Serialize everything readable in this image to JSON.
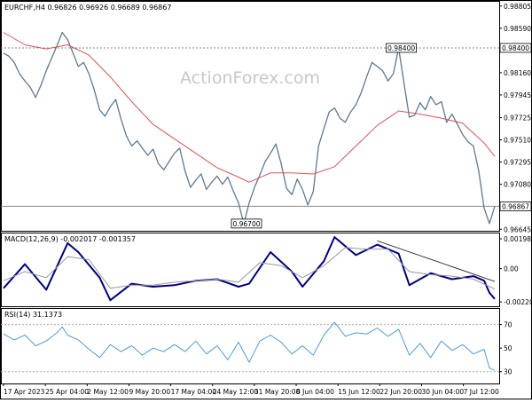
{
  "chart_data": [
    {
      "type": "line",
      "panel": "price",
      "header": "EURCHF,H4  0.96826 0.96926 0.96689 0.96867",
      "watermark": "ActionForex.com",
      "x_ticks": [
        "17 Apr 2023",
        "25 Apr 04:00",
        "2 May 12:00",
        "9 May 20:00",
        "17 May 04:00",
        "24 May 12:00",
        "31 May 20:00",
        "8 Jun 04:00",
        "15 Jun 12:00",
        "22 Jun 20:00",
        "30 Jun 04:00",
        "7 Jul 12:00"
      ],
      "y_ticks": [
        0.96645,
        0.9708,
        0.97295,
        0.9751,
        0.97725,
        0.97945,
        0.9816,
        0.9859,
        0.98805
      ],
      "ylim": [
        0.9663,
        0.98855
      ],
      "grid": false,
      "reference_lines": [
        {
          "value": 0.984,
          "label": "0.98400"
        },
        {
          "value": 0.96867,
          "label": "0.96867"
        }
      ],
      "annotations": [
        {
          "text": "0.98400",
          "x": 74.5,
          "y": 0.984
        },
        {
          "text": "0.96700",
          "x": 45.5,
          "y": 0.967
        }
      ],
      "x_max": 92,
      "series": [
        {
          "color": "#5b7a95",
          "x": [
            0,
            1,
            2,
            3,
            4,
            5,
            6,
            7,
            8,
            9,
            10,
            11,
            12,
            13,
            14,
            15,
            16,
            17,
            18,
            19,
            20,
            21,
            22,
            23,
            24,
            25,
            26,
            27,
            28,
            29,
            30,
            31,
            32,
            33,
            34,
            35,
            36,
            37,
            38,
            39,
            40,
            41,
            42,
            43,
            44,
            45,
            46,
            47,
            48,
            49,
            50,
            51,
            52,
            53,
            54,
            55,
            56,
            57,
            58,
            59,
            60,
            61,
            62,
            63,
            64,
            65,
            66,
            67,
            68,
            69,
            70,
            71,
            72,
            73,
            74,
            75,
            76,
            77,
            78,
            79,
            80,
            81,
            82,
            83,
            84,
            85,
            86,
            87,
            88,
            89,
            90,
            91,
            92
          ],
          "values": [
            0.9835,
            0.9832,
            0.9826,
            0.9815,
            0.9808,
            0.9802,
            0.9792,
            0.9804,
            0.9818,
            0.983,
            0.9842,
            0.9855,
            0.9848,
            0.9835,
            0.9822,
            0.9826,
            0.9815,
            0.9799,
            0.978,
            0.9774,
            0.9783,
            0.979,
            0.9771,
            0.9755,
            0.9745,
            0.975,
            0.9743,
            0.9736,
            0.9742,
            0.9728,
            0.9722,
            0.973,
            0.9738,
            0.9743,
            0.9721,
            0.9705,
            0.9712,
            0.9718,
            0.9703,
            0.971,
            0.9716,
            0.9708,
            0.9715,
            0.9702,
            0.969,
            0.967,
            0.969,
            0.9705,
            0.9717,
            0.973,
            0.9738,
            0.9747,
            0.9728,
            0.9704,
            0.9698,
            0.9713,
            0.9703,
            0.9688,
            0.9701,
            0.9745,
            0.9762,
            0.9778,
            0.9782,
            0.9772,
            0.9768,
            0.9778,
            0.9785,
            0.9797,
            0.9812,
            0.9826,
            0.9822,
            0.9818,
            0.9808,
            0.9815,
            0.984,
            0.9806,
            0.9773,
            0.9775,
            0.9787,
            0.978,
            0.9793,
            0.9785,
            0.9788,
            0.9768,
            0.9776,
            0.9766,
            0.9756,
            0.9749,
            0.9745,
            0.9721,
            0.9685,
            0.967,
            0.96867
          ]
        },
        {
          "color": "#e05050",
          "x": [
            0,
            4,
            8,
            12,
            16,
            20,
            24,
            28,
            32,
            36,
            40,
            44,
            46,
            50,
            54,
            58,
            62,
            66,
            70,
            74,
            78,
            82,
            86,
            90,
            92
          ],
          "values": [
            0.9855,
            0.9843,
            0.9839,
            0.9843,
            0.9833,
            0.9812,
            0.9788,
            0.9766,
            0.9752,
            0.9738,
            0.9724,
            0.9715,
            0.971,
            0.9719,
            0.9719,
            0.9718,
            0.9725,
            0.9745,
            0.9765,
            0.9779,
            0.9776,
            0.9772,
            0.9767,
            0.9748,
            0.9735
          ]
        }
      ]
    },
    {
      "type": "line",
      "panel": "macd",
      "header": "MACD(12,26,9) -0.002017 -0.001357",
      "y_ticks": [
        0.001984,
        0.0,
        -0.002208
      ],
      "ylim": [
        -0.0025,
        0.0024
      ],
      "grid": false,
      "x_max": 92,
      "trendline": {
        "x": [
          70,
          92
        ],
        "values": [
          0.00185,
          -0.00085
        ]
      },
      "series": [
        {
          "color": "#00008b",
          "x": [
            0,
            4,
            8,
            12,
            14,
            18,
            20,
            24,
            28,
            32,
            36,
            40,
            44,
            46,
            50,
            54,
            56,
            60,
            62,
            66,
            70,
            74,
            76,
            80,
            84,
            88,
            90,
            91,
            92
          ],
          "values": [
            -0.0013,
            0.0003,
            -0.0014,
            0.0017,
            0.0011,
            -0.0006,
            -0.0021,
            -0.001,
            -0.0012,
            -0.0011,
            -0.0008,
            -0.0007,
            -0.0012,
            -0.001,
            0.0011,
            -0.0002,
            -0.0012,
            0.0005,
            0.0021,
            0.0009,
            0.0016,
            0.001,
            -0.0011,
            -0.0003,
            -0.0007,
            -0.0005,
            -0.0008,
            -0.0016,
            -0.002017
          ]
        },
        {
          "color": "#999999",
          "x": [
            0,
            4,
            8,
            12,
            16,
            20,
            24,
            28,
            32,
            36,
            40,
            44,
            48,
            52,
            56,
            60,
            64,
            68,
            72,
            76,
            80,
            84,
            88,
            92
          ],
          "values": [
            -0.0008,
            -0.0002,
            -0.0006,
            0.0008,
            0.0006,
            -0.0013,
            -0.0011,
            -0.0011,
            -0.0009,
            -0.0008,
            -0.0007,
            -0.0009,
            0.0004,
            0.0002,
            -0.0006,
            0.0002,
            0.0014,
            0.0013,
            0.0013,
            -0.0002,
            -0.0004,
            -0.0005,
            -0.0007,
            -0.001357
          ]
        }
      ]
    },
    {
      "type": "line",
      "panel": "rsi",
      "header": "RSI(14) 31.1373",
      "y_ticks": [
        70,
        50,
        30
      ],
      "ylim": [
        20,
        84
      ],
      "dotted_levels": [
        70,
        30
      ],
      "grid": false,
      "x_max": 92,
      "series": [
        {
          "color": "#4a9de0",
          "x": [
            0,
            2,
            4,
            6,
            8,
            10,
            11,
            12,
            14,
            16,
            18,
            20,
            22,
            24,
            26,
            28,
            30,
            32,
            34,
            36,
            38,
            40,
            42,
            44,
            46,
            48,
            50,
            52,
            54,
            56,
            58,
            60,
            62,
            64,
            66,
            68,
            70,
            72,
            74,
            76,
            78,
            80,
            82,
            84,
            86,
            88,
            90,
            91,
            92
          ],
          "values": [
            62,
            57,
            61,
            52,
            56,
            63,
            68,
            61,
            57,
            49,
            42,
            53,
            47,
            52,
            44,
            50,
            47,
            53,
            47,
            56,
            45,
            52,
            40,
            55,
            38,
            56,
            61,
            55,
            45,
            52,
            44,
            61,
            72,
            60,
            63,
            62,
            67,
            60,
            66,
            44,
            54,
            42,
            56,
            48,
            53,
            45,
            49,
            33,
            31.1373
          ]
        }
      ]
    }
  ]
}
